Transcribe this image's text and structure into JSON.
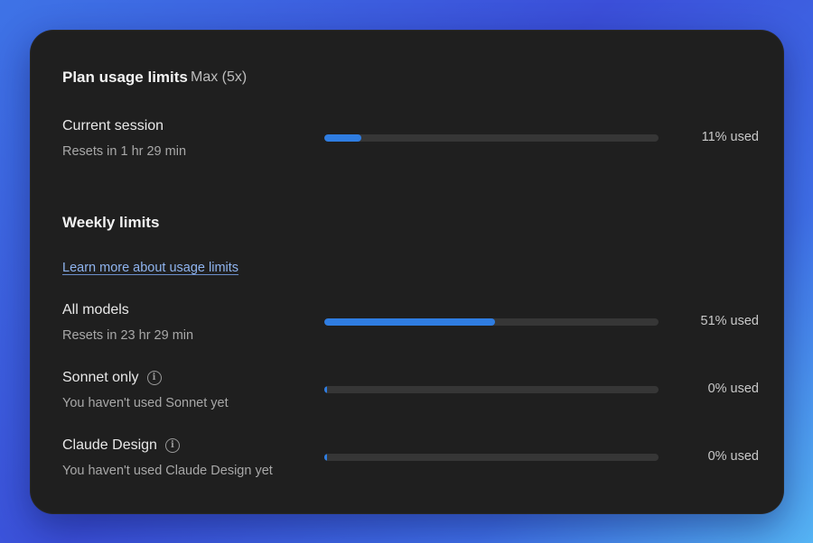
{
  "header": {
    "title": "Plan usage limits",
    "plan": "Max (5x)"
  },
  "current_session": {
    "label": "Current session",
    "subtext": "Resets in 1 hr 29 min",
    "used_percent": 11,
    "used_text": "11% used"
  },
  "weekly": {
    "title": "Weekly limits",
    "learn_more_link": "Learn more about usage limits",
    "items": [
      {
        "label": "All models",
        "subtext": "Resets in 23 hr 29 min",
        "used_percent": 51,
        "used_text": "51% used",
        "has_info": false
      },
      {
        "label": "Sonnet only",
        "subtext": "You haven't used Sonnet yet",
        "used_percent": 0,
        "used_text": "0% used",
        "has_info": true
      },
      {
        "label": "Claude Design",
        "subtext": "You haven't used Claude Design yet",
        "used_percent": 0,
        "used_text": "0% used",
        "has_info": true
      }
    ]
  },
  "colors": {
    "accent": "#2f7de1",
    "card_bg": "#1f1f1f",
    "track": "#363636",
    "link": "#8fb4ef"
  },
  "icons": {
    "info": "info-circle-icon"
  }
}
